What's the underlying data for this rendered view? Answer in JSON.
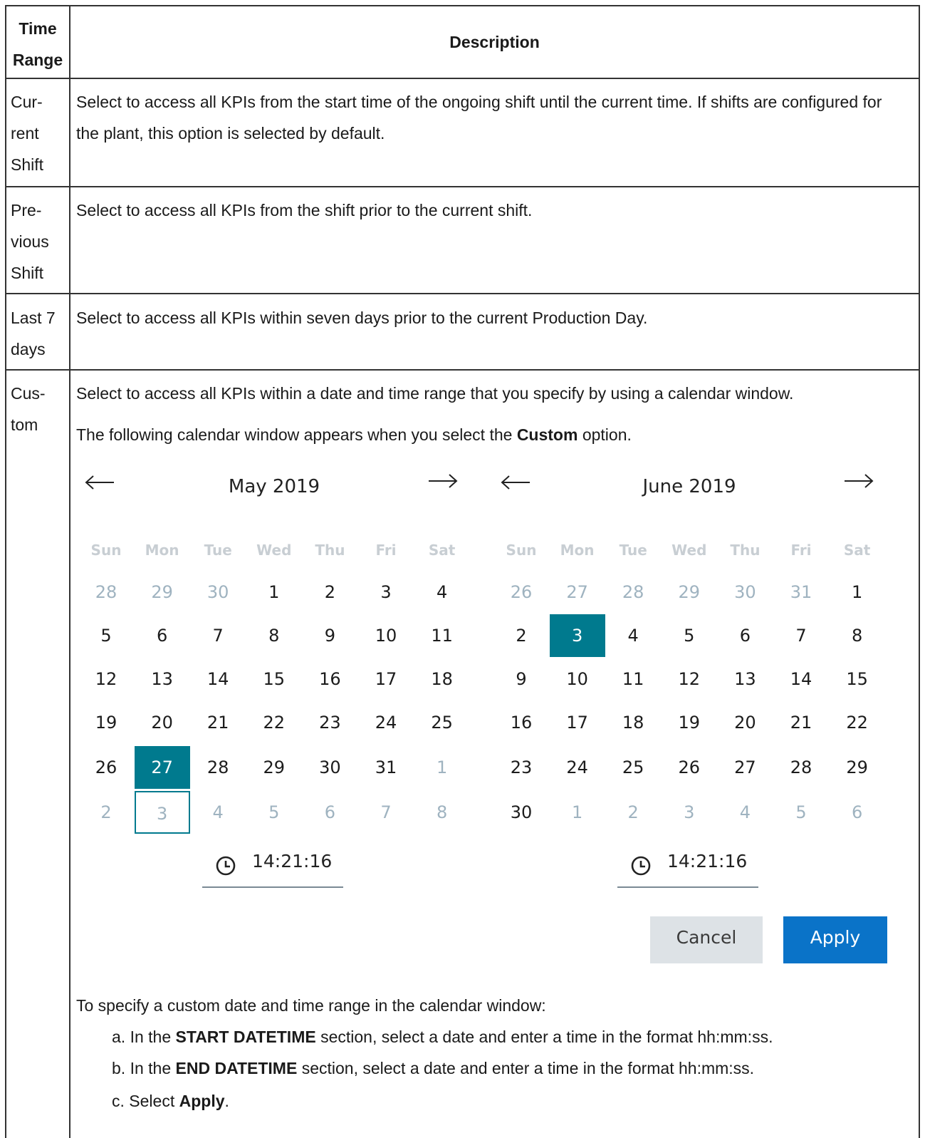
{
  "table": {
    "col1_header": "Time Range",
    "col2_header": "Description",
    "rows": [
      {
        "range_lines": [
          "Cur-",
          "rent",
          "Shift"
        ],
        "description": "Select to access all KPIs from the start time of the ongoing shift until the current time. If shifts are configured for the plant, this option is selected by default."
      },
      {
        "range_lines": [
          "Pre-",
          "vious",
          "Shift"
        ],
        "description": "Select to access all KPIs from the shift prior to the current shift."
      },
      {
        "range_lines": [
          "Last 7",
          "days"
        ],
        "description": "Select to access all KPIs within seven days prior to the current Production Day."
      },
      {
        "range_lines": [
          "Cus-",
          "tom"
        ],
        "description": "Select to access all KPIs within a date and time range that you specify by using a calendar window.",
        "intro_before": "The following calendar window appears when you select the ",
        "intro_bold": "Custom",
        "intro_after": " option."
      }
    ]
  },
  "calendar": {
    "weekdays": [
      "Sun",
      "Mon",
      "Tue",
      "Wed",
      "Thu",
      "Fri",
      "Sat"
    ],
    "left": {
      "title": "May 2019",
      "time": "14:21:16",
      "weeks": [
        [
          {
            "d": "28",
            "m": true
          },
          {
            "d": "29",
            "m": true
          },
          {
            "d": "30",
            "m": true
          },
          {
            "d": "1"
          },
          {
            "d": "2"
          },
          {
            "d": "3"
          },
          {
            "d": "4"
          }
        ],
        [
          {
            "d": "5"
          },
          {
            "d": "6"
          },
          {
            "d": "7"
          },
          {
            "d": "8"
          },
          {
            "d": "9"
          },
          {
            "d": "10"
          },
          {
            "d": "11"
          }
        ],
        [
          {
            "d": "12"
          },
          {
            "d": "13"
          },
          {
            "d": "14"
          },
          {
            "d": "15"
          },
          {
            "d": "16"
          },
          {
            "d": "17"
          },
          {
            "d": "18"
          }
        ],
        [
          {
            "d": "19"
          },
          {
            "d": "20"
          },
          {
            "d": "21"
          },
          {
            "d": "22"
          },
          {
            "d": "23"
          },
          {
            "d": "24"
          },
          {
            "d": "25"
          }
        ],
        [
          {
            "d": "26"
          },
          {
            "d": "27",
            "s": true
          },
          {
            "d": "28"
          },
          {
            "d": "29"
          },
          {
            "d": "30"
          },
          {
            "d": "31"
          },
          {
            "d": "1",
            "m": true
          }
        ],
        [
          {
            "d": "2",
            "m": true
          },
          {
            "d": "3",
            "m": true,
            "r": true
          },
          {
            "d": "4",
            "m": true
          },
          {
            "d": "5",
            "m": true
          },
          {
            "d": "6",
            "m": true
          },
          {
            "d": "7",
            "m": true
          },
          {
            "d": "8",
            "m": true
          }
        ]
      ]
    },
    "right": {
      "title": "June 2019",
      "time": "14:21:16",
      "weeks": [
        [
          {
            "d": "26",
            "m": true
          },
          {
            "d": "27",
            "m": true
          },
          {
            "d": "28",
            "m": true
          },
          {
            "d": "29",
            "m": true
          },
          {
            "d": "30",
            "m": true
          },
          {
            "d": "31",
            "m": true
          },
          {
            "d": "1"
          }
        ],
        [
          {
            "d": "2"
          },
          {
            "d": "3",
            "s": true
          },
          {
            "d": "4"
          },
          {
            "d": "5"
          },
          {
            "d": "6"
          },
          {
            "d": "7"
          },
          {
            "d": "8"
          }
        ],
        [
          {
            "d": "9"
          },
          {
            "d": "10"
          },
          {
            "d": "11"
          },
          {
            "d": "12"
          },
          {
            "d": "13"
          },
          {
            "d": "14"
          },
          {
            "d": "15"
          }
        ],
        [
          {
            "d": "16"
          },
          {
            "d": "17"
          },
          {
            "d": "18"
          },
          {
            "d": "19"
          },
          {
            "d": "20"
          },
          {
            "d": "21"
          },
          {
            "d": "22"
          }
        ],
        [
          {
            "d": "23"
          },
          {
            "d": "24"
          },
          {
            "d": "25"
          },
          {
            "d": "26"
          },
          {
            "d": "27"
          },
          {
            "d": "28"
          },
          {
            "d": "29"
          }
        ],
        [
          {
            "d": "30"
          },
          {
            "d": "1",
            "m": true
          },
          {
            "d": "2",
            "m": true
          },
          {
            "d": "3",
            "m": true
          },
          {
            "d": "4",
            "m": true
          },
          {
            "d": "5",
            "m": true
          },
          {
            "d": "6",
            "m": true
          }
        ]
      ]
    },
    "cancel_label": "Cancel",
    "apply_label": "Apply",
    "accent_color": "#007a8e",
    "apply_color": "#0a73c8"
  },
  "steps": {
    "intro": "To specify a custom date and time range in the calendar window:",
    "a_before": "a. In the ",
    "a_bold": "START DATETIME",
    "a_after": " section, select a date and enter a time in the format hh:mm:ss.",
    "b_before": "b. In the ",
    "b_bold": "END DATETIME",
    "b_after": " section, select a date and enter a time in the format hh:mm:ss.",
    "c_before": "c. Select ",
    "c_bold": "Apply",
    "c_after": "."
  }
}
